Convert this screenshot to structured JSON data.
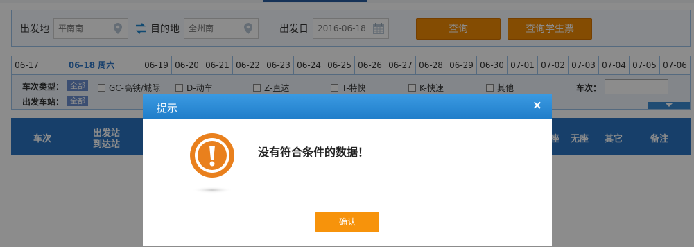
{
  "search": {
    "from_label": "出发地",
    "from_value": "平南南",
    "to_label": "目的地",
    "to_value": "全州南",
    "date_label": "出发日",
    "date_value": "2016-06-18",
    "query_button": "查询",
    "student_button": "查询学生票"
  },
  "date_tabs": [
    "06-17",
    "06-18 周六",
    "06-19",
    "06-20",
    "06-21",
    "06-22",
    "06-23",
    "06-24",
    "06-25",
    "06-26",
    "06-27",
    "06-28",
    "06-29",
    "06-30",
    "07-01",
    "07-02",
    "07-03",
    "07-04",
    "07-05",
    "07-06"
  ],
  "filters": {
    "type_label": "车次类型：",
    "all_tag": "全部",
    "station_label": "出发车站：",
    "options": [
      "GC-高铁/城际",
      "D-动车",
      "Z-直达",
      "T-特快",
      "K-快速",
      "其他"
    ],
    "train_no_label": "车次："
  },
  "table_header": {
    "train": "车次",
    "station_from": "出发站",
    "station_to": "到达站",
    "seat_partial": "座",
    "no_seat": "无座",
    "other": "其它",
    "remark": "备注"
  },
  "dialog": {
    "title": "提示",
    "close": "×",
    "message": "没有符合条件的数据！",
    "confirm": "确认"
  },
  "colors": {
    "orange": "#f08a05",
    "blue": "#2b74c1"
  }
}
